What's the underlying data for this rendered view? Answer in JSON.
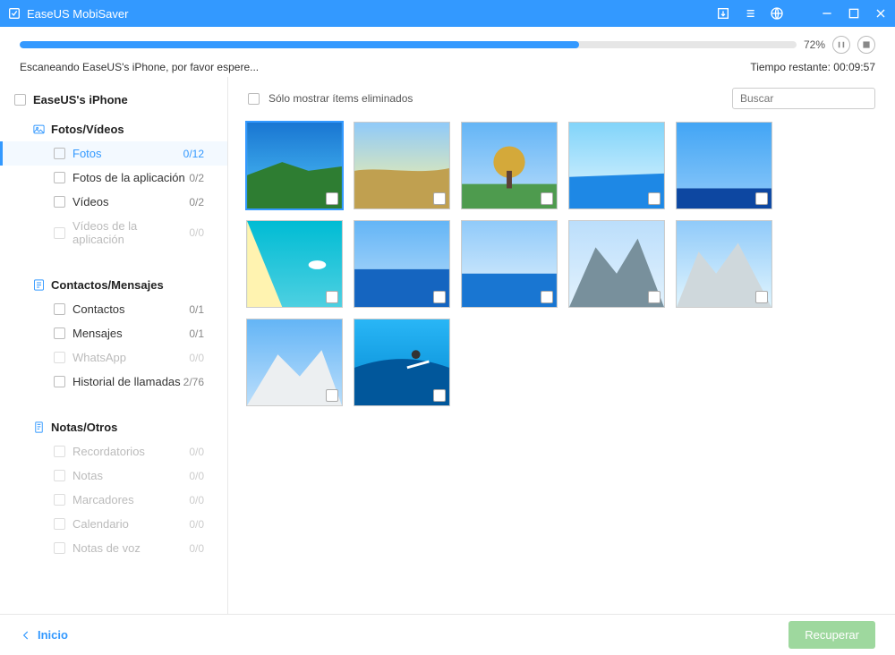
{
  "titlebar": {
    "app_name": "EaseUS MobiSaver"
  },
  "progress": {
    "percent": 72,
    "percent_label": "72%",
    "status_left": "Escaneando EaseUS's iPhone, por favor espere...",
    "status_right_label": "Tiempo restante:",
    "status_right_value": "00:09:57"
  },
  "sidebar": {
    "root_label": "EaseUS's iPhone",
    "groups": [
      {
        "label": "Fotos/Vídeos",
        "icon": "image-icon",
        "items": [
          {
            "label": "Fotos",
            "count": "0/12",
            "active": true,
            "disabled": false
          },
          {
            "label": "Fotos de la aplicación",
            "count": "0/2",
            "active": false,
            "disabled": false
          },
          {
            "label": "Vídeos",
            "count": "0/2",
            "active": false,
            "disabled": false
          },
          {
            "label": "Vídeos de la aplicación",
            "count": "0/0",
            "active": false,
            "disabled": true
          }
        ]
      },
      {
        "label": "Contactos/Mensajes",
        "icon": "contacts-icon",
        "items": [
          {
            "label": "Contactos",
            "count": "0/1",
            "active": false,
            "disabled": false
          },
          {
            "label": "Mensajes",
            "count": "0/1",
            "active": false,
            "disabled": false
          },
          {
            "label": "WhatsApp",
            "count": "0/0",
            "active": false,
            "disabled": true
          },
          {
            "label": "Historial de llamadas",
            "count": "2/76",
            "active": false,
            "disabled": false
          }
        ]
      },
      {
        "label": "Notas/Otros",
        "icon": "notes-icon",
        "items": [
          {
            "label": "Recordatorios",
            "count": "0/0",
            "active": false,
            "disabled": true
          },
          {
            "label": "Notas",
            "count": "0/0",
            "active": false,
            "disabled": true
          },
          {
            "label": "Marcadores",
            "count": "0/0",
            "active": false,
            "disabled": true
          },
          {
            "label": "Calendario",
            "count": "0/0",
            "active": false,
            "disabled": true
          },
          {
            "label": "Notas de voz",
            "count": "0/0",
            "active": false,
            "disabled": true
          }
        ]
      }
    ]
  },
  "content": {
    "filter_label": "Sólo mostrar ítems eliminados",
    "search_placeholder": "Buscar",
    "thumbs": [
      {
        "kind": "coast",
        "selected": true
      },
      {
        "kind": "field",
        "selected": false
      },
      {
        "kind": "tree",
        "selected": false
      },
      {
        "kind": "seaside",
        "selected": false
      },
      {
        "kind": "sky",
        "selected": false
      },
      {
        "kind": "beach-top",
        "selected": false
      },
      {
        "kind": "lake",
        "selected": false
      },
      {
        "kind": "pier",
        "selected": false
      },
      {
        "kind": "mountain",
        "selected": false
      },
      {
        "kind": "snow-peaks",
        "selected": false
      },
      {
        "kind": "snow-valley",
        "selected": false
      },
      {
        "kind": "surfer",
        "selected": false
      }
    ]
  },
  "footer": {
    "home_label": "Inicio",
    "recover_label": "Recuperar"
  }
}
